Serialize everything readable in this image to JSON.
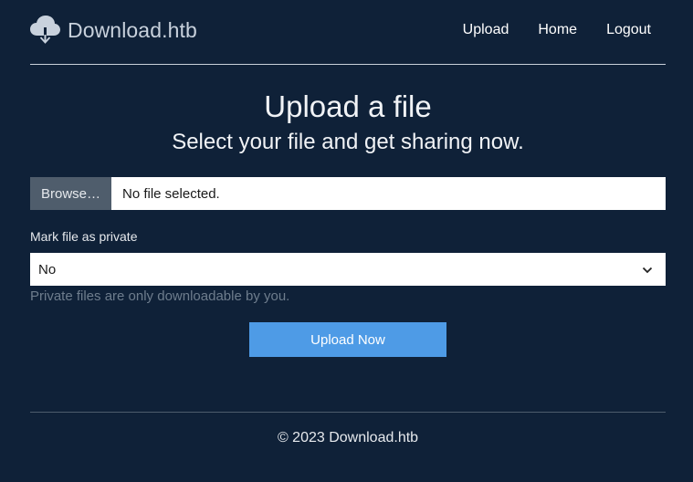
{
  "brand": {
    "name": "Download.htb",
    "icon": "cloud-download-icon"
  },
  "nav": {
    "items": [
      {
        "label": "Upload"
      },
      {
        "label": "Home"
      },
      {
        "label": "Logout"
      }
    ]
  },
  "main": {
    "title": "Upload a file",
    "subtitle": "Select your file and get sharing now.",
    "file_input": {
      "button_label": "Browse…",
      "status": "No file selected."
    },
    "private": {
      "label": "Mark file as private",
      "selected": "No",
      "help": "Private files are only downloadable by you."
    },
    "submit_label": "Upload Now"
  },
  "footer": {
    "text": "© 2023 Download.htb"
  },
  "colors": {
    "background": "#0f2138",
    "accent": "#4e9be6",
    "browse": "#4f5d6c"
  }
}
